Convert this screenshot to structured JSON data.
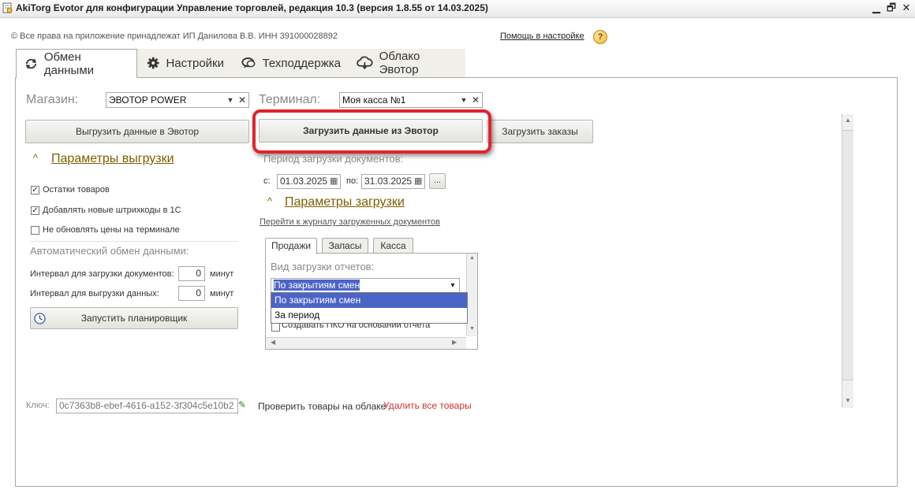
{
  "window": {
    "title": "AkiTorg Evotor для конфигурации Управление торговлей, редакция 10.3 (версия 1.8.55 от 14.03.2025)",
    "minimize": "▁",
    "restore": "🗗",
    "close": "✕"
  },
  "header": {
    "copyright": "© Все права на приложение принадлежат ИП Данилова В.В. ИНН 391000028892",
    "help_link": "Помощь в настройке",
    "help_icon_glyph": "?"
  },
  "tabs": [
    {
      "label": "Обмен данными",
      "icon": "sync-icon"
    },
    {
      "label": "Настройки",
      "icon": "gear-icon"
    },
    {
      "label": "Техподдержка",
      "icon": "chat-icon"
    },
    {
      "label": "Облако Эвотор",
      "icon": "cloud-icon"
    }
  ],
  "store": {
    "label": "Магазин:",
    "value": "ЭВОТОР POWER"
  },
  "terminal": {
    "label": "Терминал:",
    "value": "Моя касса №1"
  },
  "buttons": {
    "upload": "Выгрузить данные в Эвотор",
    "download": "Загрузить данные из Эвотор",
    "orders": "Загрузить заказы",
    "scheduler": "Запустить планировщик"
  },
  "export_params": {
    "title": "Параметры выгрузки",
    "checkboxes": [
      {
        "label": "Остатки товаров",
        "checked": true
      },
      {
        "label": "Добавлять новые штрихкоды в 1С",
        "checked": true
      },
      {
        "label": "Не обновлять цены на терминале",
        "checked": false
      }
    ],
    "auto_title": "Автоматический обмен данными:",
    "interval_download_label": "Интервал для загрузки документов:",
    "interval_download_value": "0",
    "interval_upload_label": "Интервал для выгрузки данных:",
    "interval_upload_value": "0",
    "minutes": "минут"
  },
  "import": {
    "period_label": "Период загрузки документов:",
    "from_label": "с:",
    "from_value": "01.03.2025",
    "to_label": "по:",
    "to_value": "31.03.2025",
    "ellipsis": "...",
    "params_title": "Параметры загрузки",
    "journal_link": "Перейти к журналу загруженных документов",
    "subtabs": [
      "Продажи",
      "Запасы",
      "Касса"
    ],
    "report_type_label": "Вид загрузки отчетов:",
    "report_type_value": "По закрытиям смен",
    "dropdown_options": [
      "По закрытиям смен",
      "За период"
    ],
    "pko_checkbox": "Создавать ПКО на основании отчета"
  },
  "footer": {
    "key_label": "Ключ:",
    "key_value": "0c7363b8-ebef-4616-a152-3f304c5e10b2",
    "check_link": "Проверить товары на облаке",
    "delete_link": "Удалить все товары"
  },
  "colors": {
    "highlight": "#e3222a",
    "selection": "#4b64c8",
    "section_title": "#7a5f00"
  }
}
